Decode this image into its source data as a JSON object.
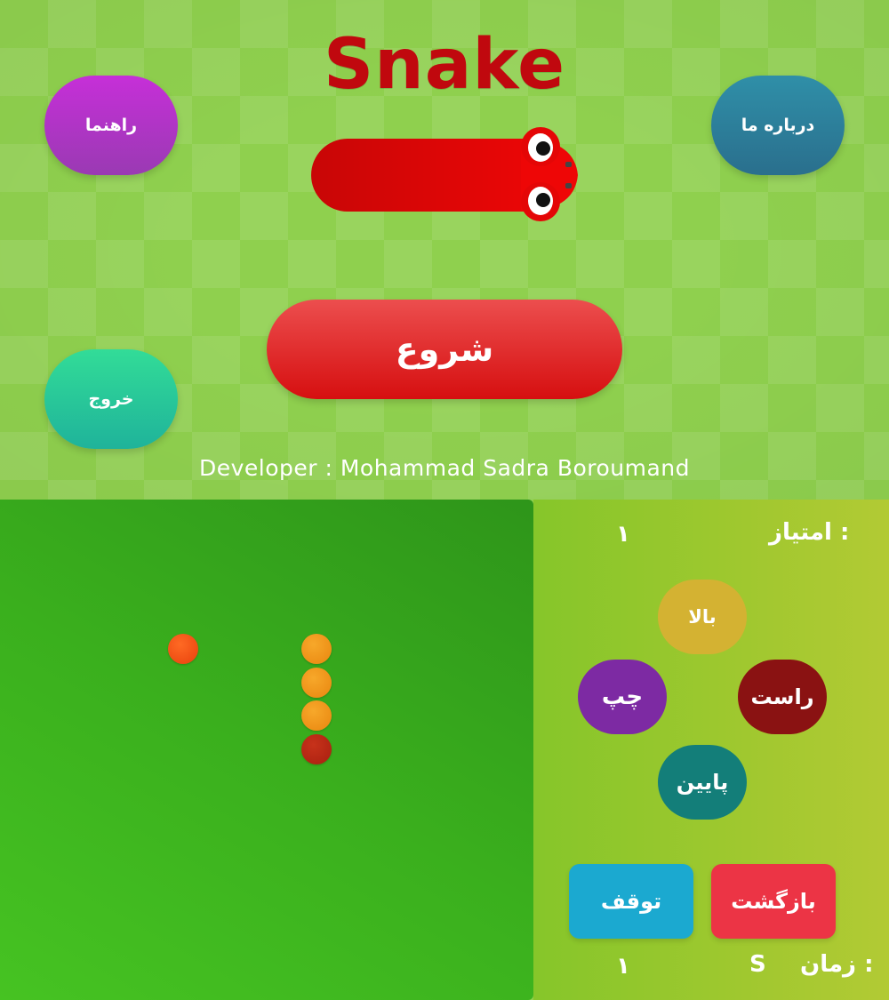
{
  "menu": {
    "title": "Snake",
    "buttons": {
      "guide": "راهنما",
      "about": "درباره ما",
      "exit": "خروج",
      "start": "شروع"
    },
    "developer": "Developer : Mohammad Sadra Boroumand"
  },
  "game": {
    "score_label": "امتیاز :",
    "score_value": "۱",
    "time_label": "زمان :",
    "time_unit": "S",
    "time_value": "۱",
    "controls": {
      "up": "بالا",
      "left": "چپ",
      "right": "راست",
      "down": "پایین"
    },
    "actions": {
      "pause": "توقف",
      "back": "بازگشت"
    },
    "colors": {
      "food": "#e8410c",
      "body": "#e9860f",
      "head": "#a81f10",
      "board": "#3aaf1d"
    }
  }
}
